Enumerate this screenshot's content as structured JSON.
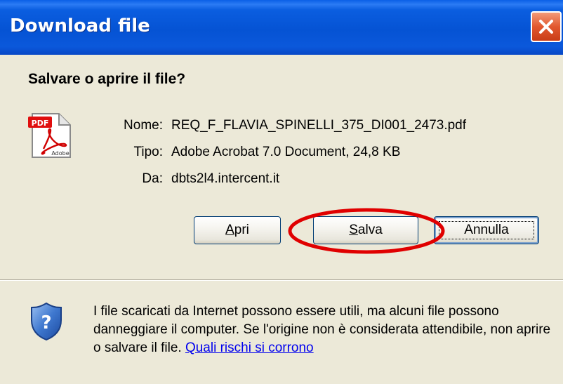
{
  "window": {
    "title": "Download file"
  },
  "dialog": {
    "question": "Salvare o aprire il file?",
    "file": {
      "name_label": "Nome:",
      "name_value": "REQ_F_FLAVIA_SPINELLI_375_DI001_2473.pdf",
      "type_label": "Tipo:",
      "type_value": "Adobe Acrobat 7.0 Document, 24,8 KB",
      "from_label": "Da:",
      "from_value": "dbts2l4.intercent.it",
      "icon": "pdf-file-icon"
    },
    "buttons": {
      "open": {
        "mnemonic": "A",
        "rest": "pri"
      },
      "save": {
        "mnemonic": "S",
        "rest": "alva"
      },
      "cancel": {
        "label": "Annulla"
      }
    },
    "warning": {
      "text": "I file scaricati da Internet possono essere utili, ma alcuni file possono danneggiare il computer. Se l'origine non è considerata attendibile, non aprire o salvare il file.",
      "link": "Quali rischi si corrono",
      "icon": "shield-question-icon"
    }
  },
  "colors": {
    "titlebar": "#0553d4",
    "dialog_bg": "#ece9d8",
    "highlight_ellipse": "#e00000",
    "link": "#0000ee"
  }
}
